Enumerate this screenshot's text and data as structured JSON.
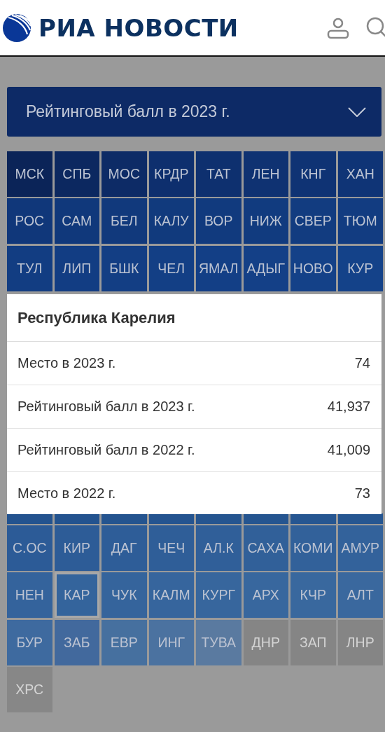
{
  "header": {
    "logo": "РИА НОВОСТИ"
  },
  "dropdown": {
    "value": "Рейтинговый балл в 2023 г."
  },
  "tiles_above": [
    {
      "label": "МСК",
      "color": "#0b2458",
      "selected": false
    },
    {
      "label": "СПБ",
      "color": "#0c2860",
      "selected": false
    },
    {
      "label": "МОС",
      "color": "#0d2b66",
      "selected": false
    },
    {
      "label": "КРДР",
      "color": "#0e2f6e",
      "selected": false
    },
    {
      "label": "ТАТ",
      "color": "#0e306f",
      "selected": false
    },
    {
      "label": "ЛЕН",
      "color": "#0f3272",
      "selected": false
    },
    {
      "label": "КНГ",
      "color": "#0f3374",
      "selected": false
    },
    {
      "label": "ХАН",
      "color": "#0f3476",
      "selected": false
    },
    {
      "label": "РОС",
      "color": "#10377a",
      "selected": false
    },
    {
      "label": "САМ",
      "color": "#10387b",
      "selected": false
    },
    {
      "label": "БЕЛ",
      "color": "#11397c",
      "selected": false
    },
    {
      "label": "КАЛУ",
      "color": "#113a7d",
      "selected": false
    },
    {
      "label": "ВОР",
      "color": "#113a7e",
      "selected": false
    },
    {
      "label": "НИЖ",
      "color": "#113b7f",
      "selected": false
    },
    {
      "label": "СВЕР",
      "color": "#123c80",
      "selected": false
    },
    {
      "label": "ТЮМ",
      "color": "#123c81",
      "selected": false
    },
    {
      "label": "ТУЛ",
      "color": "#123d82",
      "selected": false
    },
    {
      "label": "ЛИП",
      "color": "#123d83",
      "selected": false
    },
    {
      "label": "БШК",
      "color": "#133e84",
      "selected": false
    },
    {
      "label": "ЧЕЛ",
      "color": "#133f85",
      "selected": false
    },
    {
      "label": "ЯМАЛ",
      "color": "#133f86",
      "selected": false
    },
    {
      "label": "АДЫГ",
      "color": "#144087",
      "selected": false
    },
    {
      "label": "НОВО",
      "color": "#144188",
      "selected": false
    },
    {
      "label": "КУР",
      "color": "#144289",
      "selected": false
    }
  ],
  "tiles_partly_covered": [
    {
      "color": "#23538f"
    },
    {
      "color": "#23538f"
    },
    {
      "color": "#24548f"
    },
    {
      "color": "#245490"
    },
    {
      "color": "#255590"
    },
    {
      "color": "#255590"
    },
    {
      "color": "#265691"
    },
    {
      "color": "#265691"
    }
  ],
  "tiles_below": [
    {
      "label": "С.ОС",
      "color": "#2c5b97",
      "selected": false
    },
    {
      "label": "КИР",
      "color": "#2d5c97",
      "selected": false
    },
    {
      "label": "ДАГ",
      "color": "#2e5d98",
      "selected": false
    },
    {
      "label": "ЧЕЧ",
      "color": "#2f5e98",
      "selected": false
    },
    {
      "label": "АЛ.К",
      "color": "#305f99",
      "selected": false
    },
    {
      "label": "САХА",
      "color": "#316099",
      "selected": false
    },
    {
      "label": "КОМИ",
      "color": "#32619a",
      "selected": false
    },
    {
      "label": "АМУР",
      "color": "#33629b",
      "selected": false
    },
    {
      "label": "НЕН",
      "color": "#34639c",
      "selected": false
    },
    {
      "label": "КАР",
      "color": "#34649c",
      "selected": true
    },
    {
      "label": "ЧУК",
      "color": "#35649c",
      "selected": false
    },
    {
      "label": "КАЛМ",
      "color": "#36659d",
      "selected": false
    },
    {
      "label": "КУРГ",
      "color": "#37669d",
      "selected": false
    },
    {
      "label": "АРХ",
      "color": "#38679e",
      "selected": false
    },
    {
      "label": "КЧР",
      "color": "#39689e",
      "selected": false
    },
    {
      "label": "АЛТ",
      "color": "#3a689e",
      "selected": false
    },
    {
      "label": "БУР",
      "color": "#3e6a9f",
      "selected": false
    },
    {
      "label": "ЗАБ",
      "color": "#42699d",
      "selected": false
    },
    {
      "label": "ЕВР",
      "color": "#46709f",
      "selected": false
    },
    {
      "label": "ИНГ",
      "color": "#4b72a0",
      "selected": false
    },
    {
      "label": "ТУВА",
      "color": "#5a7aa0",
      "selected": false
    },
    {
      "label": "ДНР",
      "color": "#858585",
      "selected": false
    },
    {
      "label": "ЗАП",
      "color": "#858585",
      "selected": false
    },
    {
      "label": "ЛНР",
      "color": "#858585",
      "selected": false
    },
    {
      "label": "ХРС",
      "color": "#878787",
      "selected": false
    }
  ],
  "card": {
    "title": "Республика Карелия",
    "rows": [
      {
        "label": "Место в 2023 г.",
        "value": "74"
      },
      {
        "label": "Рейтинговый балл в 2023 г.",
        "value": "41,937"
      },
      {
        "label": "Рейтинговый балл в 2022 г.",
        "value": "41,009"
      },
      {
        "label": "Место в 2022 г.",
        "value": "73"
      }
    ]
  }
}
